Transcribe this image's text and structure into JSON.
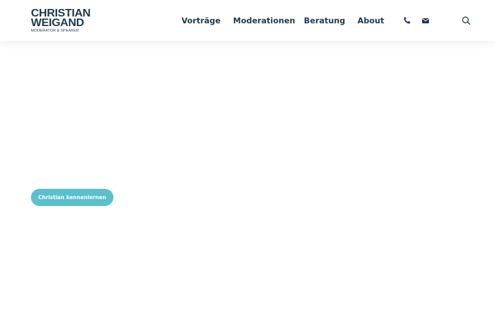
{
  "logo": {
    "line1": "CHRISTIAN",
    "line2": "WEIGAND",
    "tagline": "MODERATOR & SPEAKER"
  },
  "nav": {
    "items": [
      {
        "label": "Vorträge"
      },
      {
        "label": "Moderationen"
      },
      {
        "label": "Beratung"
      },
      {
        "label": "About"
      }
    ]
  },
  "icons": {
    "phone": "phone-icon",
    "mail": "envelope-icon",
    "search": "search-icon"
  },
  "hero": {
    "cta_label": "Christian kennenlernen"
  },
  "colors": {
    "brand": "#1f3a4d",
    "accent": "#5cbfcc",
    "background": "#ffffff"
  }
}
